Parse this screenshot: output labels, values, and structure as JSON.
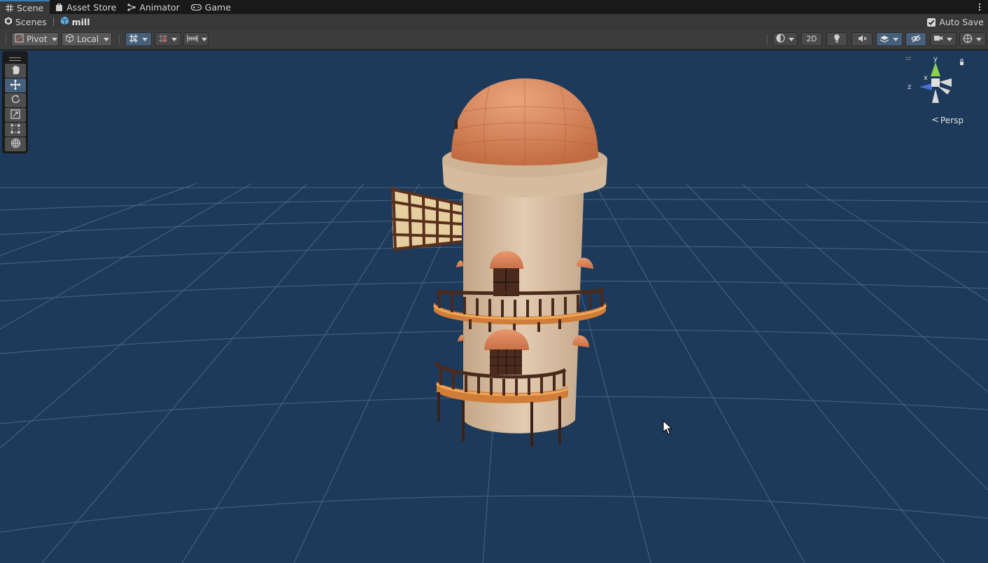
{
  "tabs": [
    {
      "label": "Scene",
      "icon": "grid-icon",
      "active": true
    },
    {
      "label": "Asset Store",
      "icon": "bag-icon",
      "active": false
    },
    {
      "label": "Animator",
      "icon": "animator-icon",
      "active": false
    },
    {
      "label": "Game",
      "icon": "gamepad-icon",
      "active": false
    }
  ],
  "breadcrumb": {
    "root": "Scenes",
    "current": "mill"
  },
  "autosave": {
    "label": "Auto Save",
    "checked": true
  },
  "toolbar": {
    "pivot": "Pivot",
    "local": "Local",
    "toggle_2d": "2D"
  },
  "gizmo": {
    "projection": "Persp",
    "axis_x": "x",
    "axis_y": "y",
    "axis_z": "z"
  },
  "tool_palette": [
    "hand-tool",
    "move-tool",
    "rotate-tool",
    "scale-tool",
    "rect-tool",
    "transform-tool"
  ],
  "colors": {
    "accent": "#3a79bb",
    "viewport_bg": "#1e3a5a",
    "roof": "#d98a5e",
    "tower": "#d7bfa3",
    "wood": "#4a2a1c"
  }
}
